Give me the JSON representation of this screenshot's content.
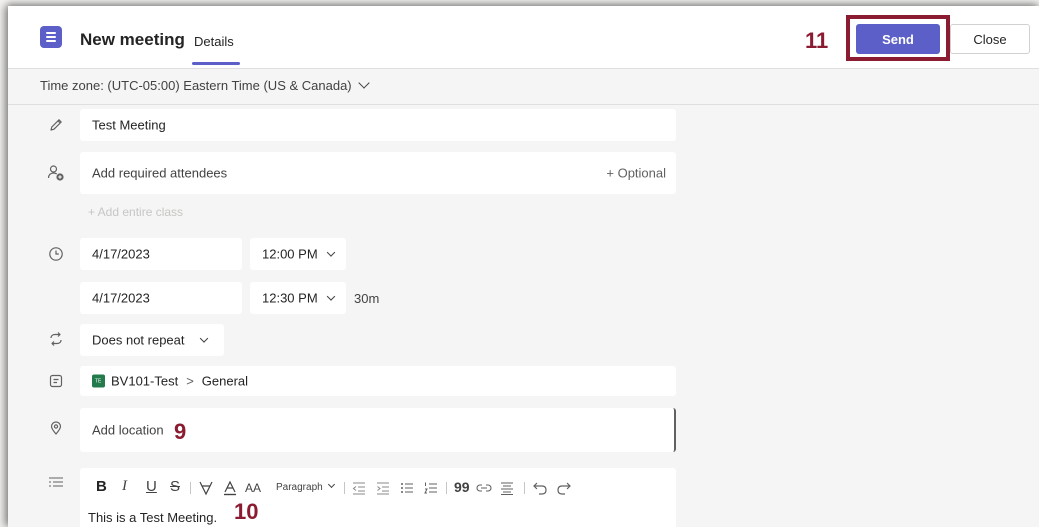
{
  "header": {
    "title": "New meeting",
    "tab_details": "Details",
    "send_label": "Send",
    "close_label": "Close",
    "annotation_send": "11"
  },
  "timezone": {
    "label": "Time zone: (UTC-05:00) Eastern Time (US & Canada)"
  },
  "form": {
    "title_value": "Test Meeting",
    "attendees_placeholder": "Add required attendees",
    "optional_label": "+ Optional",
    "add_class_label": "+ Add entire class",
    "start_date": "4/17/2023",
    "start_time": "12:00 PM",
    "end_date": "4/17/2023",
    "end_time": "12:30 PM",
    "duration": "30m",
    "repeat": "Does not repeat",
    "team_badge": "TE",
    "team": "BV101-Test",
    "channel_sep": ">",
    "channel": "General",
    "location_placeholder": "Add location",
    "annotation_location": "9"
  },
  "editor": {
    "bold": "B",
    "italic": "I",
    "underline": "U",
    "strike": "S",
    "font_size": "AA",
    "paragraph": "Paragraph",
    "quote": "99",
    "body": "This is a Test Meeting.",
    "annotation_body": "10"
  },
  "colors": {
    "accent": "#5b5fc7",
    "annotation": "#8b1b31",
    "team_badge": "#237b4b"
  }
}
